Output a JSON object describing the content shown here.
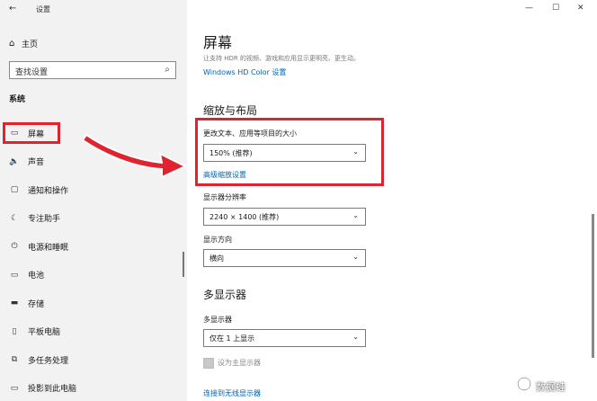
{
  "window": {
    "title": "设置",
    "back_glyph": "←",
    "controls": [
      "—",
      "☐",
      "✕"
    ]
  },
  "sidebar": {
    "home_label": "主页",
    "search_placeholder": "查找设置",
    "section_label": "系统",
    "items": [
      {
        "label": "屏幕",
        "icon": "monitor-icon",
        "glyph": "▭"
      },
      {
        "label": "声音",
        "icon": "speaker-icon",
        "glyph": "🔈"
      },
      {
        "label": "通知和操作",
        "icon": "notification-icon",
        "glyph": "▢"
      },
      {
        "label": "专注助手",
        "icon": "moon-icon",
        "glyph": "☾"
      },
      {
        "label": "电源和睡眠",
        "icon": "power-icon",
        "glyph": "⏻"
      },
      {
        "label": "电池",
        "icon": "battery-icon",
        "glyph": "▭"
      },
      {
        "label": "存储",
        "icon": "storage-icon",
        "glyph": "▬"
      },
      {
        "label": "平板电脑",
        "icon": "tablet-icon",
        "glyph": "▯"
      },
      {
        "label": "多任务处理",
        "icon": "multitask-icon",
        "glyph": "⧉"
      },
      {
        "label": "投影到此电脑",
        "icon": "projector-icon",
        "glyph": "▭"
      }
    ]
  },
  "main": {
    "title": "屏幕",
    "description": "让支持 HDR 的视频、游戏和应用显示更明亮、更生动。",
    "hd_color_link": "Windows HD Color 设置",
    "scale_heading": "缩放与布局",
    "scale_label": "更改文本、应用等项目的大小",
    "scale_value": "150% (推荐)",
    "advanced_scale_link": "高级缩放设置",
    "resolution_label": "显示器分辨率",
    "resolution_value": "2240 × 1400 (推荐)",
    "orientation_label": "显示方向",
    "orientation_value": "横向",
    "multi_heading": "多显示器",
    "multi_label": "多显示器",
    "multi_value": "仅在 1 上显示",
    "primary_checkbox_label": "设为主显示器",
    "wireless_link": "连接到无线显示器"
  },
  "watermark": "数据蛙",
  "colors": {
    "highlight": "#e0232e",
    "link": "#0063b1",
    "sidebar_bg": "#f2f2f2"
  }
}
